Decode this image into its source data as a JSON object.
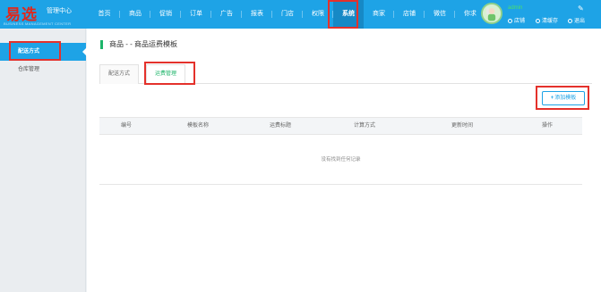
{
  "brand": {
    "logo_text": "易选",
    "center_label": "管理中心",
    "subtitle": "BUSINESS MANAGEMENT CENTER"
  },
  "nav": {
    "items": [
      {
        "label": "首页",
        "width": 35
      },
      {
        "label": "商品",
        "width": 34
      },
      {
        "label": "促销",
        "width": 34
      },
      {
        "label": "订单",
        "width": 34
      },
      {
        "label": "广告",
        "width": 34
      },
      {
        "label": "报表",
        "width": 34
      },
      {
        "label": "门店",
        "width": 34
      },
      {
        "label": "权限",
        "width": 34
      },
      {
        "label": "系统",
        "width": 34,
        "active": true
      },
      {
        "label": "商家",
        "width": 34
      },
      {
        "label": "店铺",
        "width": 34
      },
      {
        "label": "微信",
        "width": 34
      },
      {
        "label": "你求",
        "width": 34
      }
    ]
  },
  "user": {
    "name": "admin",
    "links": {
      "shop": "店铺",
      "cache": "清缓存",
      "logout": "退出"
    }
  },
  "sidebar": {
    "items": [
      {
        "label": "配送方式",
        "active": true
      },
      {
        "label": "仓库管理",
        "active": false
      }
    ]
  },
  "main": {
    "title": "商品 - - 商品运费模板",
    "tabs": [
      {
        "label": "配送方式"
      },
      {
        "label": "运费管理",
        "active": true
      }
    ],
    "add_button": "添加模板",
    "table": {
      "columns": [
        "编号",
        "模板名称",
        "运费标题",
        "计算方式",
        "更新时间",
        "操作"
      ],
      "empty_text": "没有找到任何记录"
    }
  },
  "colors": {
    "primary": "#1ea3e6",
    "active_nav": "#1689c6",
    "accent_green": "#1db56a",
    "logo_red": "#e0271b",
    "highlight_red": "#e4312b"
  }
}
